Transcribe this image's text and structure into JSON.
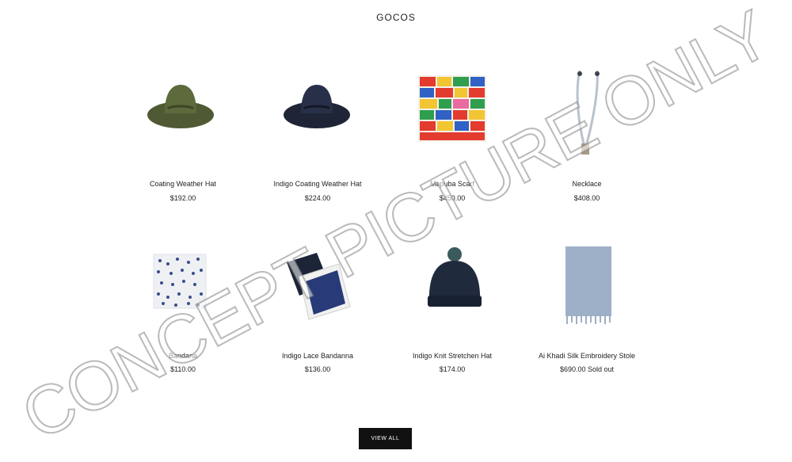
{
  "header": {
    "brand": "GOCOS"
  },
  "products": [
    {
      "name": "Coating Weather Hat",
      "price": "$192.00",
      "image": "olive-wide-brim-hat"
    },
    {
      "name": "Indigo Coating Weather Hat",
      "price": "$224.00",
      "image": "navy-wide-brim-hat"
    },
    {
      "name": "Mapuba Scarf",
      "price": "$450.00",
      "image": "multicolor-patchwork-textile"
    },
    {
      "name": "Necklace",
      "price": "$408.00",
      "image": "beaded-necklace"
    },
    {
      "name": "Bandana",
      "price": "$110.00",
      "image": "white-indigo-print-bandana"
    },
    {
      "name": "Indigo Lace Bandanna",
      "price": "$136.00",
      "image": "folded-indigo-bandanna"
    },
    {
      "name": "Indigo Knit Stretchen Hat",
      "price": "$174.00",
      "image": "navy-knit-pompom-hat"
    },
    {
      "name": "Ai Khadi Silk Embroidery Stole",
      "price": "$690.00 Sold out",
      "image": "light-blue-fringed-stole"
    }
  ],
  "actions": {
    "view_all": "VIEW ALL"
  },
  "watermark": "CONCEPT PICTURE ONLY"
}
